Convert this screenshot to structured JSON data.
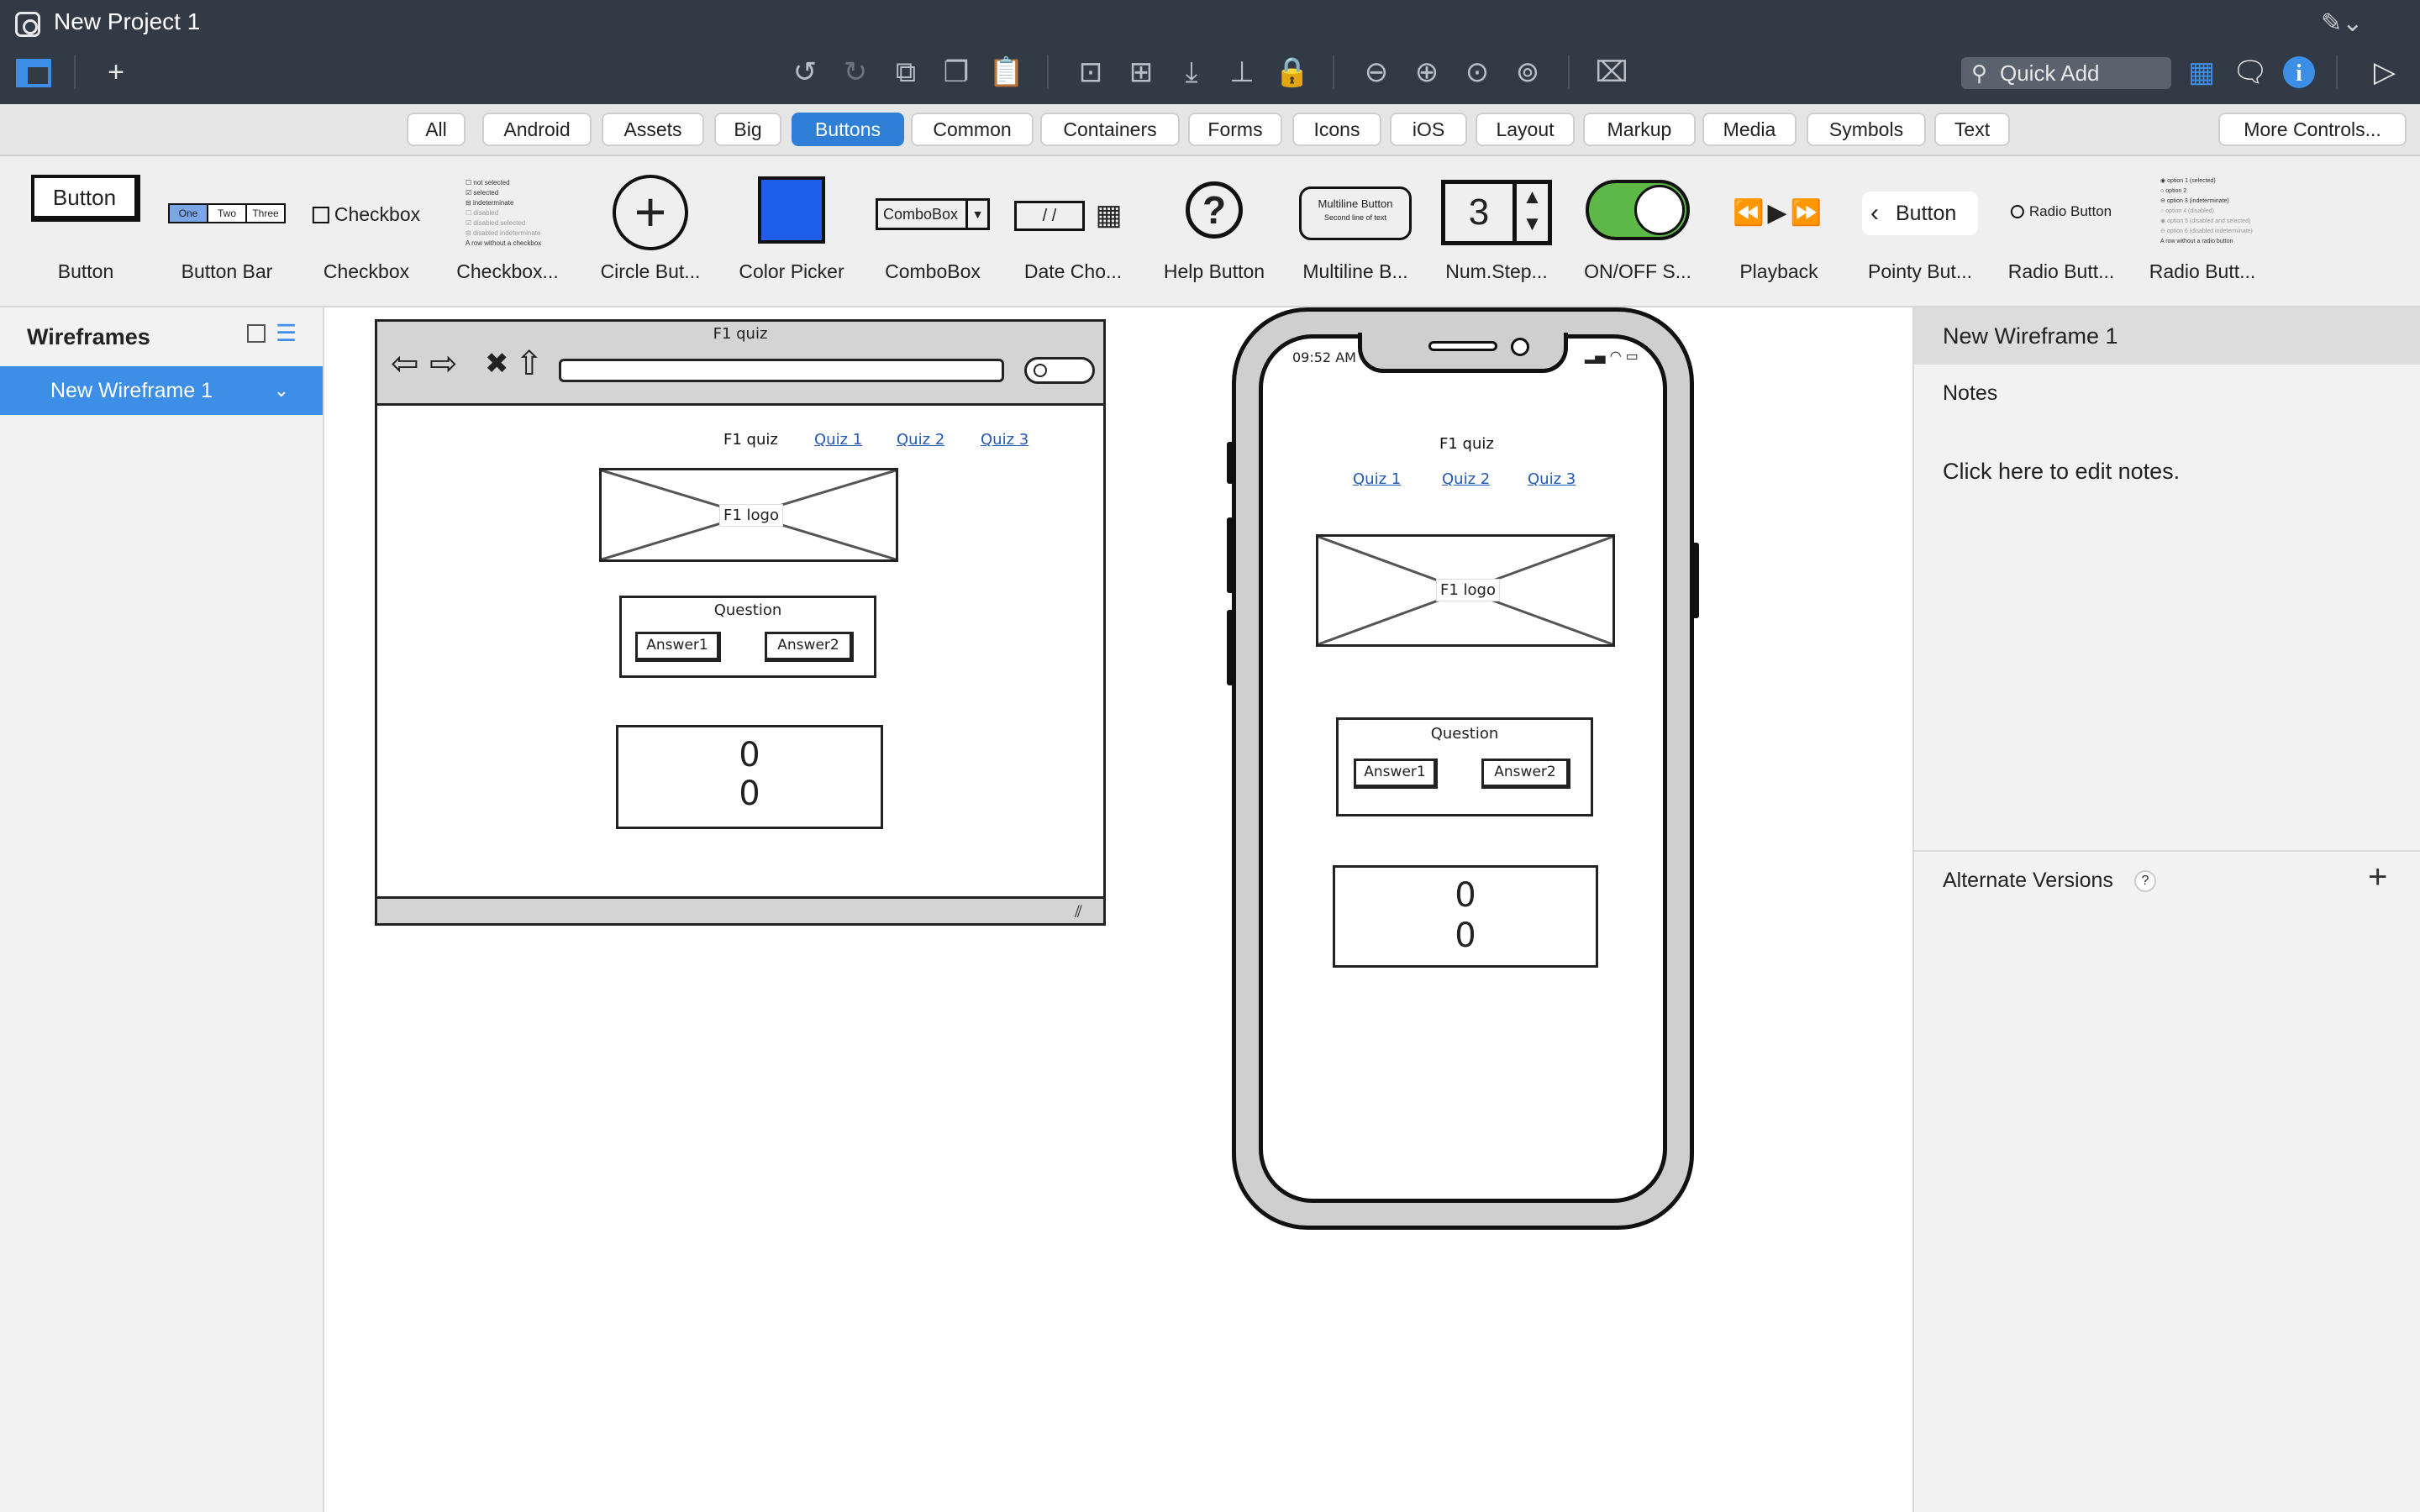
{
  "app": {
    "title": "New Project 1"
  },
  "toolbar": {
    "quick_add_placeholder": "Quick Add"
  },
  "library_tabs": [
    "All",
    "Android",
    "Assets",
    "Big",
    "Buttons",
    "Common",
    "Containers",
    "Forms",
    "Icons",
    "iOS",
    "Layout",
    "Markup",
    "Media",
    "Symbols",
    "Text"
  ],
  "library_active_tab": "Buttons",
  "more_controls_label": "More Controls...",
  "components": [
    {
      "label": "Button",
      "preview": "Button"
    },
    {
      "label": "Button Bar",
      "preview": [
        "One",
        "Two",
        "Three"
      ]
    },
    {
      "label": "Checkbox",
      "preview": "Checkbox"
    },
    {
      "label": "Checkbox...",
      "preview": [
        "not selected",
        "selected",
        "indeterminate",
        "disabled",
        "disabled selected",
        "disabled indeterminate",
        "A row without a checkbox"
      ]
    },
    {
      "label": "Circle But...",
      "preview": "+"
    },
    {
      "label": "Color Picker",
      "preview": ""
    },
    {
      "label": "ComboBox",
      "preview": "ComboBox"
    },
    {
      "label": "Date Cho...",
      "preview": "/ /"
    },
    {
      "label": "Help Button",
      "preview": "?"
    },
    {
      "label": "Multiline B...",
      "preview": [
        "Multiline Button",
        "Second line of text"
      ]
    },
    {
      "label": "Num.Step...",
      "preview": "3"
    },
    {
      "label": "ON/OFF S...",
      "preview": ""
    },
    {
      "label": "Playback",
      "preview": ""
    },
    {
      "label": "Pointy But...",
      "preview": "Button"
    },
    {
      "label": "Radio Butt...",
      "preview": "Radio Button"
    },
    {
      "label": "Radio Butt...",
      "preview": [
        "option 1 (selected)",
        "option 2",
        "option 3 (indeterminate)",
        "option 4 (disabled)",
        "option 5 (disabled and selected)",
        "option 6 (disabled indeterminate)",
        "A row without a radio button"
      ]
    }
  ],
  "left_panel": {
    "header": "Wireframes",
    "items": [
      "New Wireframe 1"
    ]
  },
  "right_panel": {
    "title": "New Wireframe 1",
    "notes_label": "Notes",
    "notes_placeholder": "Click here to edit notes.",
    "alternate_versions_label": "Alternate Versions",
    "help_glyph": "?"
  },
  "browser_wireframe": {
    "title": "F1 quiz",
    "nav_title": "F1 quiz",
    "nav_links": [
      "Quiz 1",
      "Quiz 2",
      "Quiz 3"
    ],
    "logo_label": "F1 logo",
    "question": "Question",
    "answers": [
      "Answer1",
      "Answer2"
    ],
    "scores": [
      "0",
      "0"
    ]
  },
  "phone_wireframe": {
    "time": "09:52 AM",
    "nav_title": "F1 quiz",
    "nav_links": [
      "Quiz 1",
      "Quiz 2",
      "Quiz 3"
    ],
    "logo_label": "F1 logo",
    "question": "Question",
    "answers": [
      "Answer1",
      "Answer2"
    ],
    "scores": [
      "0",
      "0"
    ]
  }
}
